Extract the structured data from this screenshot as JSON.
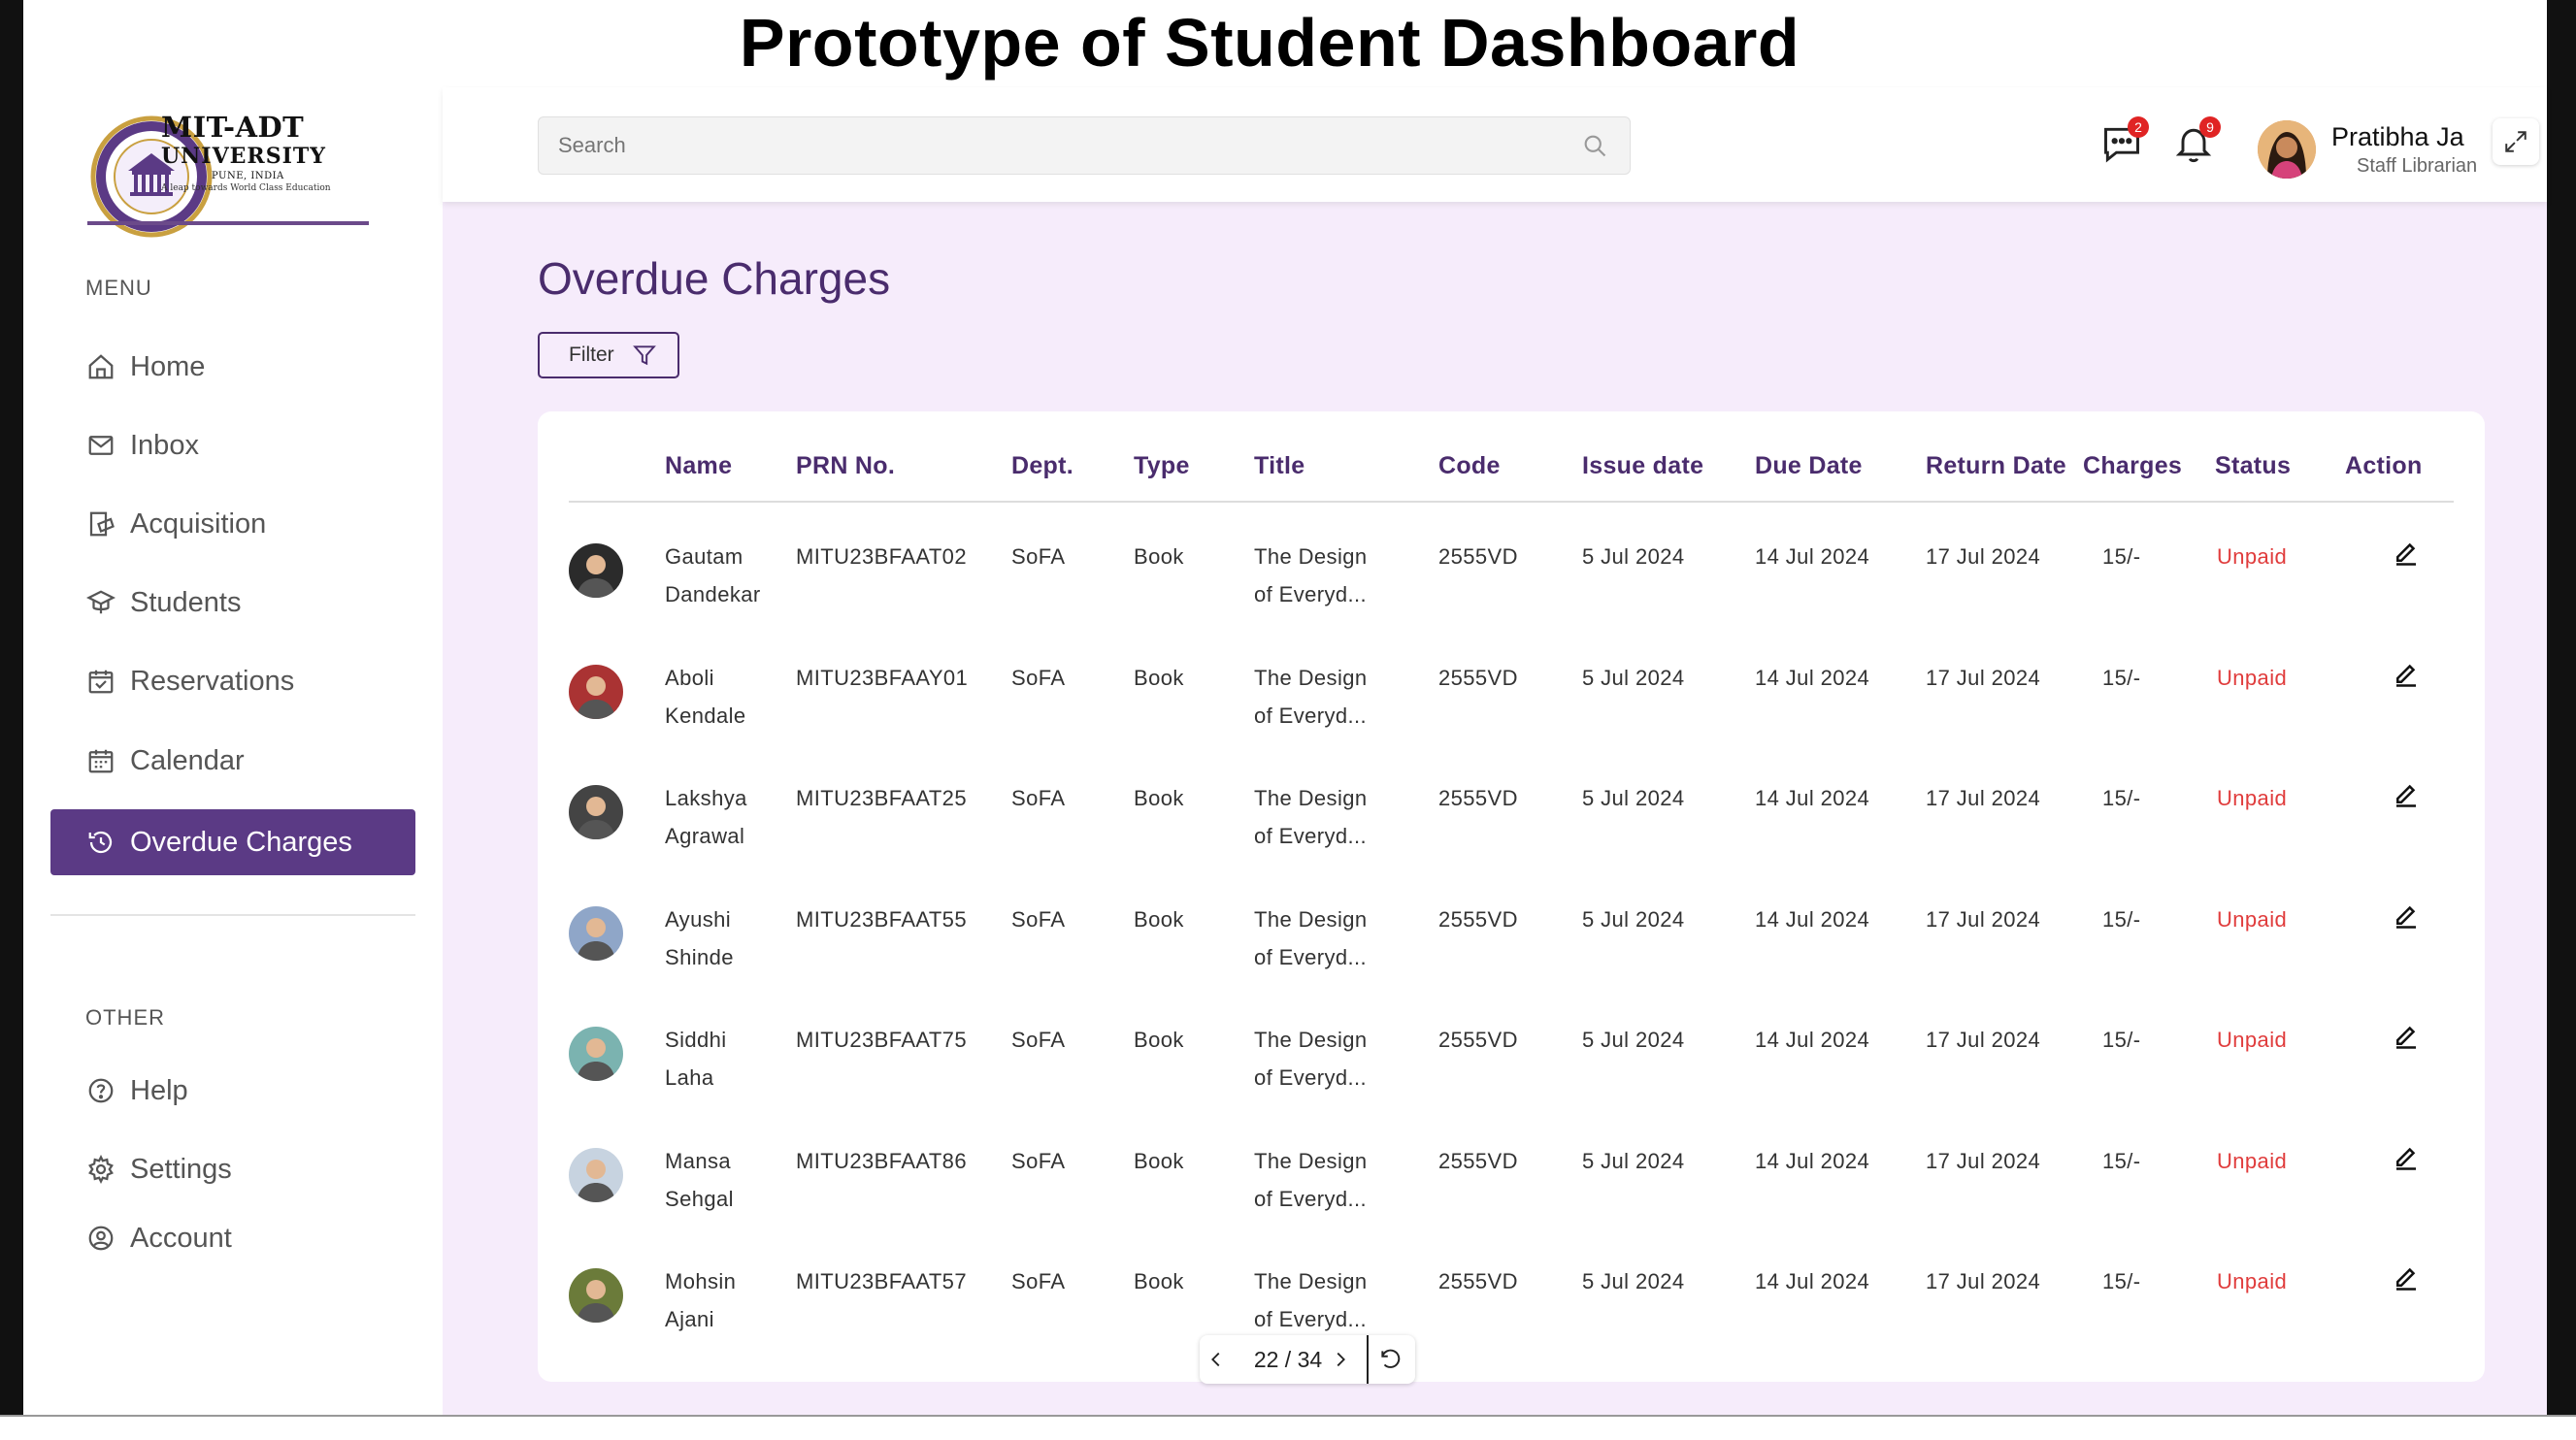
{
  "prototype_title": "Prototype of Student Dashboard",
  "logo": {
    "line1": "MIT-ADT",
    "line2": "UNIVERSITY",
    "line3": "PUNE, INDIA",
    "tagline": "A leap towards World Class Education"
  },
  "sidebar": {
    "menu_heading": "MENU",
    "items": [
      {
        "label": "Home",
        "icon": "home-icon"
      },
      {
        "label": "Inbox",
        "icon": "mail-icon"
      },
      {
        "label": "Acquisition",
        "icon": "acquisition-icon"
      },
      {
        "label": "Students",
        "icon": "graduation-cap-icon"
      },
      {
        "label": "Reservations",
        "icon": "calendar-check-icon"
      },
      {
        "label": "Calendar",
        "icon": "calendar-icon"
      },
      {
        "label": "Overdue Charges",
        "icon": "clock-history-icon",
        "active": true
      }
    ],
    "other_heading": "OTHER",
    "other_items": [
      {
        "label": "Help",
        "icon": "help-icon"
      },
      {
        "label": "Settings",
        "icon": "gear-icon"
      },
      {
        "label": "Account",
        "icon": "account-icon"
      }
    ]
  },
  "header": {
    "search_placeholder": "Search",
    "messages_count": "2",
    "notifications_count": "9",
    "user_name": "Pratibha Ja",
    "user_role": "Staff Librarian"
  },
  "main": {
    "title": "Overdue Charges",
    "filter_label": "Filter",
    "columns": [
      "Name",
      "PRN No.",
      "Dept.",
      "Type",
      "Title",
      "Code",
      "Issue date",
      "Due Date",
      "Return Date",
      "Charges",
      "Status",
      "Action"
    ],
    "rows": [
      {
        "first": "Gautam",
        "last": "Dandekar",
        "prn": "MITU23BFAAT02",
        "dept": "SoFA",
        "type": "Book",
        "title1": "The Design",
        "title2": "of Everyd...",
        "code": "2555VD",
        "issue": "5 Jul 2024",
        "due": "14 Jul 2024",
        "ret": "17 Jul 2024",
        "charges": "15/-",
        "status": "Unpaid"
      },
      {
        "first": "Aboli",
        "last": "Kendale",
        "prn": "MITU23BFAAY01",
        "dept": "SoFA",
        "type": "Book",
        "title1": "The Design",
        "title2": "of Everyd...",
        "code": "2555VD",
        "issue": "5 Jul 2024",
        "due": "14 Jul 2024",
        "ret": "17 Jul 2024",
        "charges": "15/-",
        "status": "Unpaid"
      },
      {
        "first": "Lakshya",
        "last": "Agrawal",
        "prn": "MITU23BFAAT25",
        "dept": "SoFA",
        "type": "Book",
        "title1": "The Design",
        "title2": "of Everyd...",
        "code": "2555VD",
        "issue": "5 Jul 2024",
        "due": "14 Jul 2024",
        "ret": "17 Jul 2024",
        "charges": "15/-",
        "status": "Unpaid"
      },
      {
        "first": "Ayushi",
        "last": "Shinde",
        "prn": "MITU23BFAAT55",
        "dept": "SoFA",
        "type": "Book",
        "title1": "The Design",
        "title2": "of Everyd...",
        "code": "2555VD",
        "issue": "5 Jul 2024",
        "due": "14 Jul 2024",
        "ret": "17 Jul 2024",
        "charges": "15/-",
        "status": "Unpaid"
      },
      {
        "first": "Siddhi",
        "last": "Laha",
        "prn": "MITU23BFAAT75",
        "dept": "SoFA",
        "type": "Book",
        "title1": "The Design",
        "title2": "of Everyd...",
        "code": "2555VD",
        "issue": "5 Jul 2024",
        "due": "14 Jul 2024",
        "ret": "17 Jul 2024",
        "charges": "15/-",
        "status": "Unpaid"
      },
      {
        "first": "Mansa",
        "last": "Sehgal",
        "prn": "MITU23BFAAT86",
        "dept": "SoFA",
        "type": "Book",
        "title1": "The Design",
        "title2": "of Everyd...",
        "code": "2555VD",
        "issue": "5 Jul 2024",
        "due": "14 Jul 2024",
        "ret": "17 Jul 2024",
        "charges": "15/-",
        "status": "Unpaid"
      },
      {
        "first": "Mohsin",
        "last": "Ajani",
        "prn": "MITU23BFAAT57",
        "dept": "SoFA",
        "type": "Book",
        "title1": "The Design",
        "title2": "of Everyd...",
        "code": "2555VD",
        "issue": "5 Jul 2024",
        "due": "14 Jul 2024",
        "ret": "17 Jul 2024",
        "charges": "15/-",
        "status": "Unpaid"
      }
    ]
  },
  "pager": {
    "text": "22 / 34"
  },
  "colors": {
    "accent": "#5b3a85",
    "heading": "#4a2c6d",
    "background": "#f6ecfb",
    "status_unpaid": "#e03c3c",
    "badge": "#e02424"
  }
}
